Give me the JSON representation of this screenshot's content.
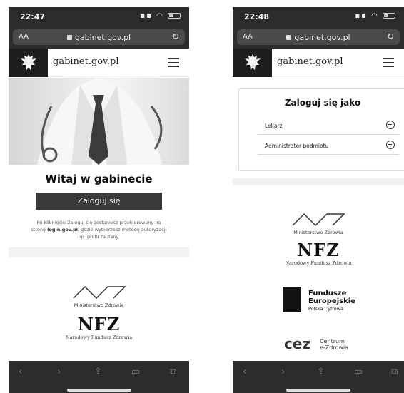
{
  "left": {
    "status": {
      "time": "22:47"
    },
    "browser": {
      "aa": "AA",
      "url": "gabinet.gov.pl",
      "reload_icon": "reload-icon"
    },
    "header": {
      "site_name": "gabinet.gov.pl"
    },
    "hero": {
      "icon": "doctor-photo"
    },
    "main": {
      "welcome": "Witaj w gabinecie",
      "login_button": "Zaloguj się",
      "info_pre": "Po kliknięciu Zaloguj się zostaniesz przekierowany na stronę ",
      "info_bold": "login.gov.pl",
      "info_post": ", gdzie wybierzesz metodę autoryzacji np. profil zaufany."
    },
    "footer": {
      "ministry": "Ministerstwo Zdrowia",
      "nfz": "NFZ",
      "nfz_caption": "Narodowy Fundusz Zdrowia"
    }
  },
  "right": {
    "status": {
      "time": "22:48"
    },
    "browser": {
      "aa": "AA",
      "url": "gabinet.gov.pl",
      "reload_icon": "reload-icon"
    },
    "header": {
      "site_name": "gabinet.gov.pl"
    },
    "login_card": {
      "title": "Zaloguj się jako",
      "options": [
        {
          "label": "Lekarz",
          "icon": "stethoscope-icon"
        },
        {
          "label": "Administrator podmiotu",
          "icon": "stethoscope-icon"
        }
      ]
    },
    "footer": {
      "ministry": "Ministerstwo Zdrowia",
      "nfz": "NFZ",
      "nfz_caption": "Narodowy Fundusz Zdrowia",
      "fe_line1": "Fundusze",
      "fe_line2": "Europejskie",
      "fe_line3": "Polska Cyfrowa",
      "cez_logo": "cez",
      "cez_line1": "Centrum",
      "cez_line2": "e-Zdrowia"
    }
  }
}
